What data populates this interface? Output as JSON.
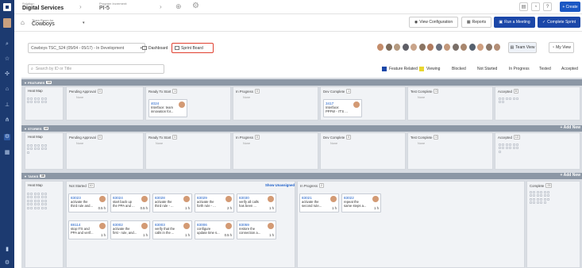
{
  "topbar": {
    "solution_label": "Solution:",
    "solution_name": "Digital Services",
    "pi_label": "Program Increment:",
    "pi_name": "PI-5",
    "create_label": "+ Create"
  },
  "header": {
    "team_label": "Team Room for",
    "team_name": "Cowboys",
    "view_config": "View Configuration",
    "reports": "Reports",
    "run_meeting": "Run a Meeting",
    "complete_sprint": "Complete Sprint"
  },
  "controls": {
    "sprint_select": "Cowboys TSC_S24 (05/04 - 05/17) - In Development",
    "dashboard": "Dashboard",
    "sprint_board": "Sprint Board",
    "team_view": "Team View",
    "my_view": "My View",
    "search_placeholder": "Search by ID or Title"
  },
  "legend": {
    "feature_related": "Feature Related",
    "viewing": "Viewing",
    "blocked": "Blocked",
    "not_started": "Not Started",
    "in_progress": "In Progress",
    "tested": "Tested",
    "accepted": "Accepted",
    "feature_color": "#1b47a8",
    "viewing_color": "#e8d630"
  },
  "features": {
    "title": "FEATURES",
    "count": "10",
    "cols": [
      {
        "label": "Heat Map",
        "count": ""
      },
      {
        "label": "Pending Approval",
        "count": "0"
      },
      {
        "label": "Ready To Start",
        "count": "1"
      },
      {
        "label": "In Progress",
        "count": "0"
      },
      {
        "label": "Dev Complete",
        "count": "1"
      },
      {
        "label": "Test Complete",
        "count": "0"
      },
      {
        "label": "Accepted",
        "count": "8"
      }
    ],
    "none": "None",
    "card1": {
      "id": "4024",
      "l1": "Interface: team",
      "l2": "innovation for..."
    },
    "card2": {
      "id": "3417",
      "l1": "Interface:",
      "l2": "PPFW - IT'S ..."
    }
  },
  "stories": {
    "title": "STORIES",
    "count": "13",
    "add_new": "+ Add New",
    "cols": [
      {
        "label": "Heat Map",
        "count": ""
      },
      {
        "label": "Pending Approval",
        "count": "0"
      },
      {
        "label": "Ready To Start",
        "count": "0"
      },
      {
        "label": "In Progress",
        "count": "0"
      },
      {
        "label": "Dev Complete",
        "count": "0"
      },
      {
        "label": "Test Complete",
        "count": "0"
      },
      {
        "label": "Accepted",
        "count": "13"
      }
    ],
    "none": "None"
  },
  "tasks": {
    "title": "TASKS",
    "count": "35",
    "add_new": "+ Add New",
    "cols": [
      {
        "label": "Heat Map",
        "count": ""
      },
      {
        "label": "Not Started",
        "count": "10"
      },
      {
        "label": "In Progress",
        "count": "2"
      },
      {
        "label": "Complete",
        "count": "23"
      }
    ],
    "show_unassigned": "Show Unassigned",
    "cards": [
      {
        "id": "83023",
        "l1": "activate the",
        "l2": "third rule and...",
        "h": "0.5 h"
      },
      {
        "id": "83024",
        "l1": "start back up",
        "l2": "the PPA and ...",
        "h": "0.5 h"
      },
      {
        "id": "83028",
        "l1": "activate the",
        "l2": "third rule - ...",
        "h": "1 h"
      },
      {
        "id": "83029",
        "l1": "activate the",
        "l2": "forth rule - ...",
        "h": "2 h"
      },
      {
        "id": "83030",
        "l1": "verify all calls",
        "l2": "has been ...",
        "h": "1 h"
      },
      {
        "id": "83021",
        "l1": "activate the",
        "l2": "second rule...",
        "h": "1 h"
      },
      {
        "id": "83022",
        "l1": "repeat the",
        "l2": "same steps a...",
        "h": "1 h"
      },
      {
        "id": "88114",
        "l1": "stop ITS and",
        "l2": "PPA and verif...",
        "h": "1 h"
      },
      {
        "id": "83002",
        "l1": "activate the",
        "l2": "first - rule, and...",
        "h": "1 h"
      },
      {
        "id": "83003",
        "l1": "verify that the",
        "l2": "calls in the ...",
        "h": "1 h"
      },
      {
        "id": "83006",
        "l1": "configure",
        "l2": "update time s...",
        "h": "0.5 h"
      },
      {
        "id": "83059",
        "l1": "restore the",
        "l2": "connection a...",
        "h": "1 h"
      }
    ]
  }
}
